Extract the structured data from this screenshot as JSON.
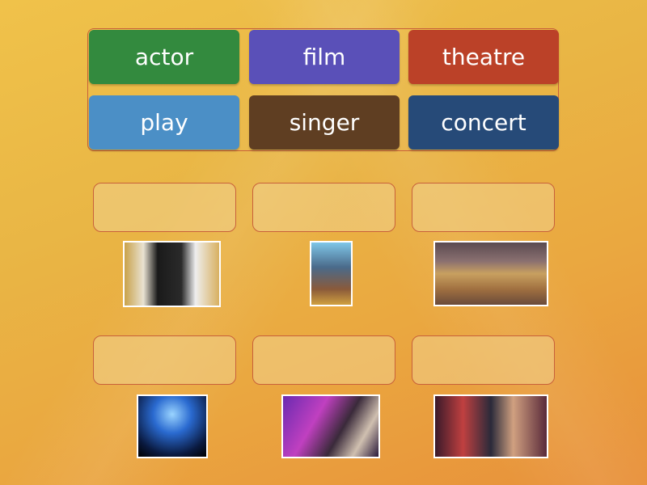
{
  "words": [
    {
      "label": "actor",
      "color": "#338a3e"
    },
    {
      "label": "film",
      "color": "#5a50b8"
    },
    {
      "label": "theatre",
      "color": "#bb4128"
    },
    {
      "label": "play",
      "color": "#4b8fc6"
    },
    {
      "label": "singer",
      "color": "#5f3e22"
    },
    {
      "label": "concert",
      "color": "#264a78"
    }
  ],
  "images": [
    {
      "name": "actor-at-oscars-image"
    },
    {
      "name": "film-poster-image"
    },
    {
      "name": "theatre-hall-image"
    },
    {
      "name": "concert-crowd-image"
    },
    {
      "name": "singer-performing-image"
    },
    {
      "name": "play-stage-image"
    }
  ]
}
